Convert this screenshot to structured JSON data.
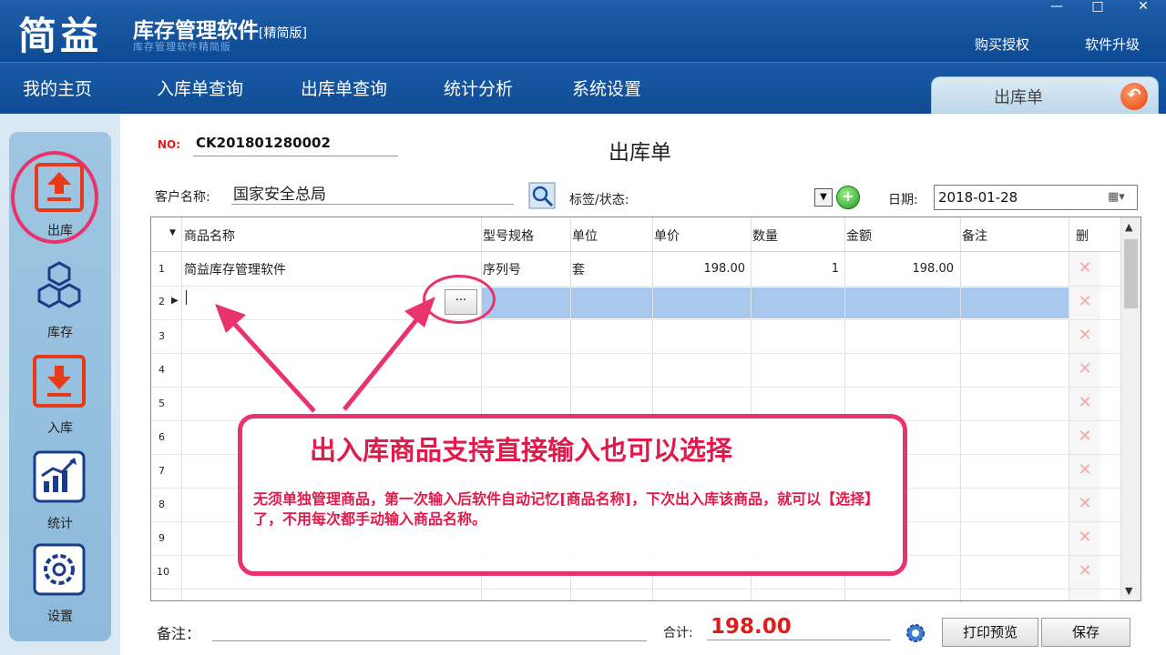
{
  "header": {
    "logo": "简益",
    "app_title": "库存管理软件",
    "app_edition": "[精简版]",
    "subtitle": "库存管理软件精简版",
    "buy_link": "购买授权",
    "upgrade_link": "软件升级",
    "minimize": "—",
    "maximize": "□",
    "close": "✕"
  },
  "nav": {
    "items": [
      "我的主页",
      "入库单查询",
      "出库单查询",
      "统计分析",
      "系统设置"
    ],
    "active_tab": "出库单",
    "back_icon": "↶"
  },
  "sidebar": {
    "items": [
      {
        "label": "出库",
        "icon": "outbound-icon"
      },
      {
        "label": "库存",
        "icon": "inventory-cubes-icon"
      },
      {
        "label": "入库",
        "icon": "inbound-icon"
      },
      {
        "label": "统计",
        "icon": "chart-icon"
      },
      {
        "label": "设置",
        "icon": "gear-icon"
      }
    ]
  },
  "form": {
    "no_label": "NO:",
    "no_value": "CK201801280002",
    "title": "出库单",
    "customer_label": "客户名称:",
    "customer_value": "国家安全总局",
    "tag_label": "标签/状态:",
    "date_label": "日期:",
    "date_value": "2018-01-28"
  },
  "grid": {
    "headers": [
      "商品名称",
      "型号规格",
      "单位",
      "单价",
      "数量",
      "金额",
      "备注",
      "删"
    ],
    "rows": [
      {
        "num": "1",
        "name": "简益库存管理软件",
        "spec": "序列号",
        "unit": "套",
        "price": "198.00",
        "qty": "1",
        "amount": "198.00",
        "remark": ""
      },
      {
        "num": "2",
        "name": "",
        "spec": "",
        "unit": "",
        "price": "",
        "qty": "",
        "amount": "",
        "remark": ""
      },
      {
        "num": "3"
      },
      {
        "num": "4"
      },
      {
        "num": "5"
      },
      {
        "num": "6"
      },
      {
        "num": "7"
      },
      {
        "num": "8"
      },
      {
        "num": "9"
      },
      {
        "num": "10"
      }
    ],
    "ellipsis": "···",
    "delete_glyph": "✕"
  },
  "annotation": {
    "title": "出入库商品支持直接输入也可以选择",
    "text": "无须单独管理商品，第一次输入后软件自动记忆[商品名称]，下次出入库该商品，就可以【选择】了，不用每次都手动输入商品名称。"
  },
  "footer": {
    "remark_label": "备注：",
    "total_label": "合计:",
    "total_value": "198.00",
    "print_preview": "打印预览",
    "save": "保存"
  },
  "colors": {
    "header_blue": "#0c4a93",
    "accent_pink": "#e8336d",
    "total_red": "#e01b1b",
    "selected_row": "#a9c8ee"
  }
}
